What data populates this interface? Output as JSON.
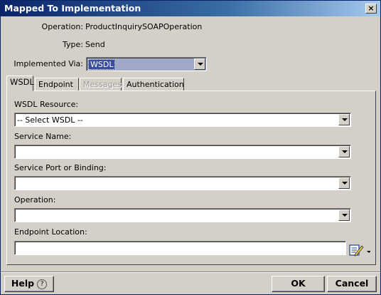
{
  "window": {
    "title": "Mapped To Implementation",
    "close_glyph": "×"
  },
  "info": {
    "operation_label": "Operation:",
    "operation_value": "ProductInquirySOAPOperation",
    "type_label": "Type:",
    "type_value": "Send",
    "implemented_label": "Implemented Via:",
    "implemented_value": "WSDL"
  },
  "tabs": [
    {
      "label": "WSDL",
      "state": "active"
    },
    {
      "label": "Endpoint",
      "state": "normal"
    },
    {
      "label": "Messages",
      "state": "disabled"
    },
    {
      "label": "Authentication",
      "state": "normal"
    }
  ],
  "form": {
    "wsdl_resource_label": "WSDL Resource:",
    "wsdl_resource_value": "-- Select WSDL --",
    "service_name_label": "Service Name:",
    "service_name_value": "",
    "service_port_label": "Service Port or Binding:",
    "service_port_value": "",
    "operation_label": "Operation:",
    "operation_value": "",
    "endpoint_label": "Endpoint Location:",
    "endpoint_value": ""
  },
  "footer": {
    "help_label": "Help",
    "help_glyph": "?",
    "ok_label": "OK",
    "cancel_label": "Cancel"
  },
  "colors": {
    "title_start": "#0a246a",
    "title_end": "#a6caf0",
    "face": "#d4d0c8",
    "selection": "#3a4da0"
  },
  "icons": {
    "edit": "edit-pencil-icon",
    "dropdown": "dropdown-arrow-icon"
  }
}
